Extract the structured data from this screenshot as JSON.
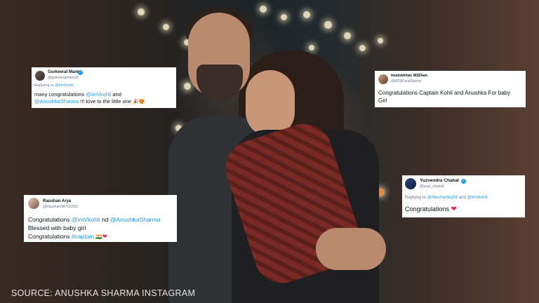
{
  "source_caption": "SOURCE: ANUSHKA SHARMA INSTAGRAM",
  "colors": {
    "mention": "#1d9bf0",
    "heart": "#e0245e",
    "verified": "#1d9bf0"
  },
  "tweets": [
    {
      "name": "Gurkeerat Mann",
      "handle": "@gurkeeratmann22",
      "verified": true,
      "replying_to": "Replying to",
      "replying_mention": "@imVkohli",
      "text_1": "many congratulations ",
      "mention_1": "@imVkohli",
      "text_2": " and",
      "mention_2": "@AnushkaSharma",
      "text_3": " !!! love to the little one",
      "emoji": "🎉😍"
    },
    {
      "name": "Imalokkhan MSDian",
      "handle": "@MSDFansWarrior",
      "text": "Congratulations Captain Kohli and Anushka For baby",
      "text_2": "Girl"
    },
    {
      "name": "Raushan Arya",
      "handle": "@RaushanS87511832",
      "text_1": "Congratulations ",
      "mention_1": "@imVkohli",
      "text_2": "  nd ",
      "mention_2": "@AnushkaSharma",
      "line_2": "Blessed with baby girl",
      "line_3": "Congratulations ",
      "hashtag": "#captain",
      "emoji": "🇮🇳",
      "heart": "❤"
    },
    {
      "name": "Yuzvendra Chahal",
      "handle": "@yuzi_chahal",
      "verified": true,
      "replying_to": "Replying to ",
      "replying_mention_1": "@AlexHartley93",
      "replying_and": " and ",
      "replying_mention_2": "@imVkohli",
      "text": "Congratulations ",
      "heart": "❤"
    }
  ]
}
